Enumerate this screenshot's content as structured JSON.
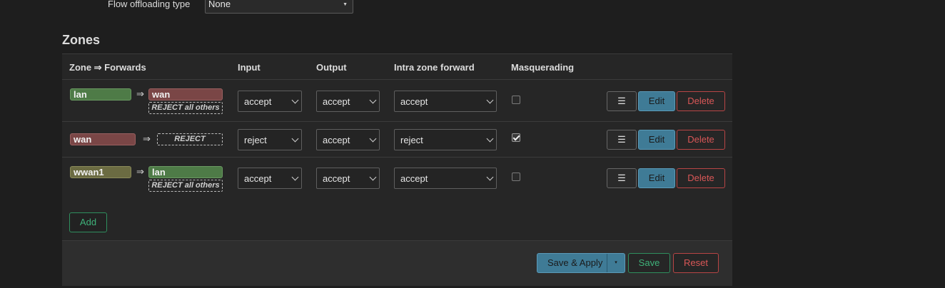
{
  "flow_offloading": {
    "label": "Flow offloading type",
    "value": "None"
  },
  "zones": {
    "title": "Zones",
    "columns": {
      "zone_forwards": "Zone ⇒ Forwards",
      "input": "Input",
      "output": "Output",
      "intra_zone_forward": "Intra zone forward",
      "masquerading": "Masquerading"
    },
    "arrow": "⇒",
    "rows": [
      {
        "zone": "lan",
        "zone_color": "#4e7b47",
        "forward": "wan",
        "forward_color": "#7a4646",
        "reject_note": "REJECT all others",
        "input": "accept",
        "output": "accept",
        "intra": "accept",
        "masquerading": false
      },
      {
        "zone": "wan",
        "zone_color": "#7a4646",
        "reject_note": "REJECT",
        "input": "reject",
        "output": "accept",
        "intra": "reject",
        "masquerading": true
      },
      {
        "zone": "wwan1",
        "zone_color": "#6b6b42",
        "forward": "lan",
        "forward_color": "#4e7b47",
        "reject_note": "REJECT all others",
        "input": "accept",
        "output": "accept",
        "intra": "accept",
        "masquerading": false
      }
    ],
    "row_buttons": {
      "menu_icon": "☰",
      "edit": "Edit",
      "delete": "Delete"
    },
    "add_label": "Add"
  },
  "footer": {
    "save_apply": "Save & Apply",
    "dropdown_icon": "▾",
    "save": "Save",
    "reset": "Reset"
  }
}
